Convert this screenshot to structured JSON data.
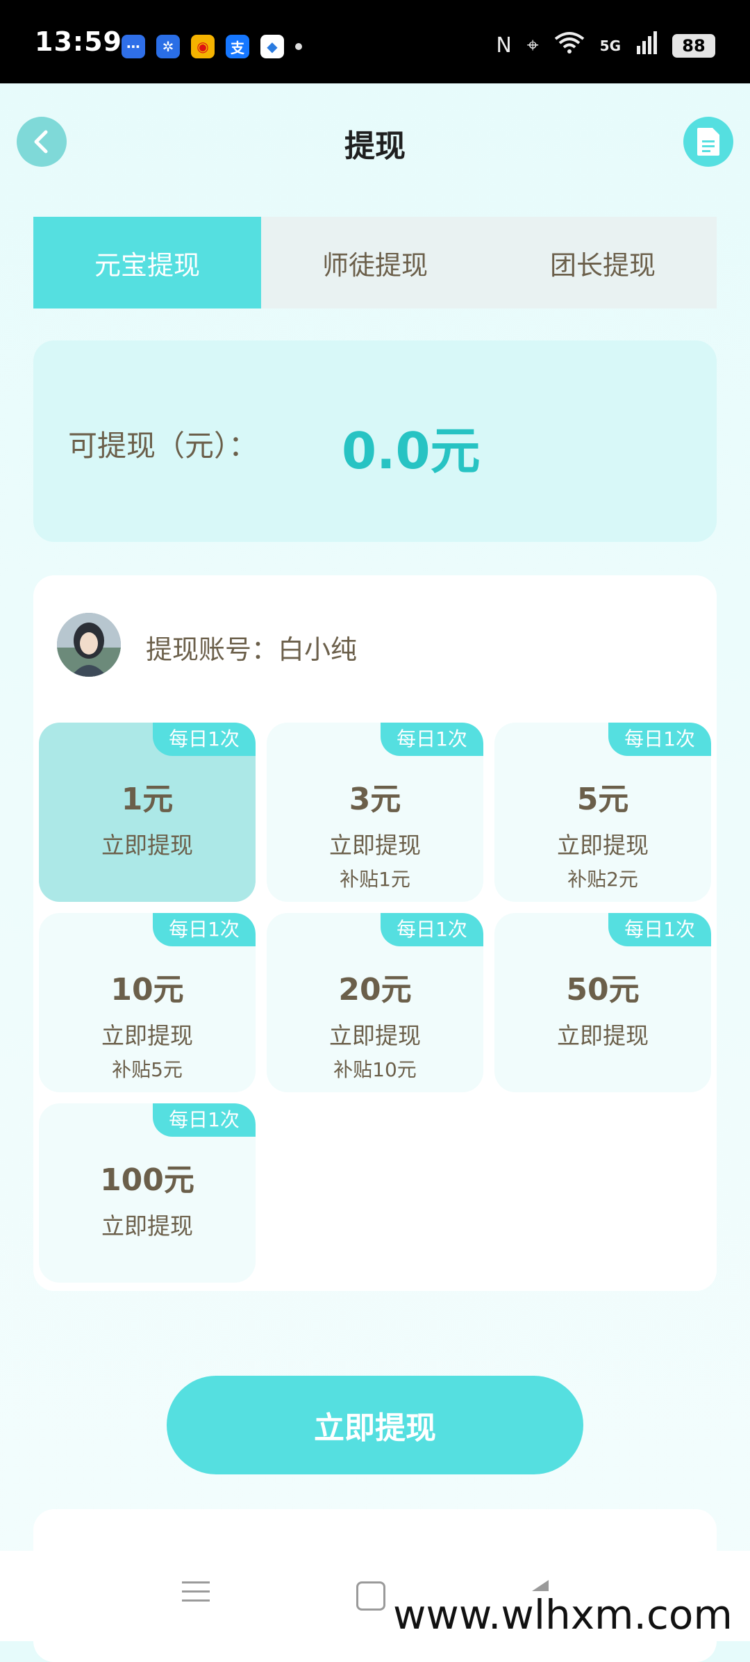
{
  "status_bar": {
    "time": "13:59",
    "app_icons": [
      {
        "name": "message-app-icon",
        "glyph": "⋯",
        "color": "#2f6fe8"
      },
      {
        "name": "fan-app-icon",
        "glyph": "✲",
        "color": "#2a6ee6"
      },
      {
        "name": "weibo-icon",
        "glyph": "◉",
        "color": "#f5b300"
      },
      {
        "name": "alipay-icon",
        "glyph": "支",
        "color": "#1677ff"
      },
      {
        "name": "browser-icon",
        "glyph": "◆",
        "color": "#ffffff"
      }
    ],
    "nfc_icon": "N",
    "network": "5G",
    "battery": "88"
  },
  "header": {
    "title": "提现"
  },
  "tabs": [
    {
      "label": "元宝提现",
      "active": true
    },
    {
      "label": "师徒提现",
      "active": false
    },
    {
      "label": "团长提现",
      "active": false
    }
  ],
  "balance": {
    "label": "可提现（元）：",
    "value": "0.0元"
  },
  "account": {
    "label": "提现账号：白小纯"
  },
  "options": [
    {
      "badge": "每日1次",
      "amount": "1元",
      "action": "立即提现",
      "subsidy": "",
      "selected": true
    },
    {
      "badge": "每日1次",
      "amount": "3元",
      "action": "立即提现",
      "subsidy": "补贴1元",
      "selected": false
    },
    {
      "badge": "每日1次",
      "amount": "5元",
      "action": "立即提现",
      "subsidy": "补贴2元",
      "selected": false
    },
    {
      "badge": "每日1次",
      "amount": "10元",
      "action": "立即提现",
      "subsidy": "补贴5元",
      "selected": false
    },
    {
      "badge": "每日1次",
      "amount": "20元",
      "action": "立即提现",
      "subsidy": "补贴10元",
      "selected": false
    },
    {
      "badge": "每日1次",
      "amount": "50元",
      "action": "立即提现",
      "subsidy": "",
      "selected": false
    },
    {
      "badge": "每日1次",
      "amount": "100元",
      "action": "立即提现",
      "subsidy": "",
      "selected": false
    }
  ],
  "withdraw_button": "立即提现",
  "watermark": "www.wlhxm.com",
  "colors": {
    "accent": "#55dfe0",
    "selected_option": "#ace8e7",
    "balance_value": "#27c3c3",
    "text_brown": "#6b5f4a"
  }
}
